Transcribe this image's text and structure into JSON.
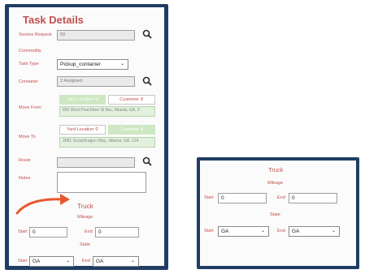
{
  "task_details": {
    "title": "Task Details",
    "service_request": {
      "label": "Service Request",
      "value": "93"
    },
    "commodity": {
      "label": "Commodity"
    },
    "task_type": {
      "label": "Task Type",
      "value": "Pickup_container"
    },
    "container": {
      "label": "Container",
      "value": "2 Assigned"
    },
    "move_from": {
      "label": "Move From",
      "tab_yard": "Yard Location",
      "tab_customer": "Customer",
      "address": "850 West Peachtree St Nw., Atlanta, GA, 3"
    },
    "move_to": {
      "label": "Move To",
      "tab_yard": "Yard Location",
      "tab_customer": "Customer",
      "address": "3081 ScrapDragon Way., Atlanta, GA, 124"
    },
    "route": {
      "label": "Route",
      "value": ""
    },
    "notes": {
      "label": "Notes",
      "value": ""
    }
  },
  "truck_left": {
    "title": "Truck",
    "mileage_label": "Mileage",
    "start_label": "Start",
    "start_value": "0",
    "end_label": "End",
    "end_value": "0",
    "state_label": "State",
    "state_start_label": "Start",
    "state_start_value": "GA",
    "state_end_label": "End",
    "state_end_value": "GA"
  },
  "truck_right": {
    "title": "Truck",
    "mileage_label": "Mileage",
    "start_label": "Start",
    "start_value": "0",
    "end_label": "End",
    "end_value": "0",
    "state_label": "State",
    "state_start_label": "Start",
    "state_start_value": "GA",
    "state_end_label": "End",
    "state_end_value": "GA"
  },
  "colors": {
    "accent": "#c0504d",
    "frame": "#1f3d63",
    "arrow": "#e8582e",
    "tab_green": "#cde8c3"
  },
  "icons": [
    "search-icon",
    "chevron-down-icon",
    "arrow-icon"
  ]
}
